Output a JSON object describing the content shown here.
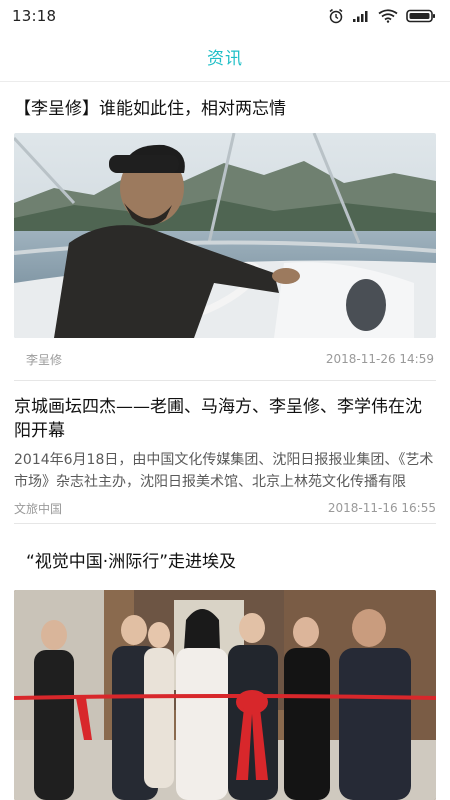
{
  "status_bar": {
    "time": "13:18",
    "icons": [
      "alarm-icon",
      "signal-icon",
      "wifi-icon",
      "battery-icon"
    ]
  },
  "header": {
    "title": "资讯",
    "accent_color": "#1fbfc7"
  },
  "articles": [
    {
      "title": "【李呈修】谁能如此住，相对两忘情",
      "image": "man-on-boat-photo",
      "source": "李呈修",
      "date": "2018-11-26 14:59"
    },
    {
      "title": "京城画坛四杰——老圃、马海方、李呈修、李学伟在沈阳开幕",
      "summary": "2014年6月18日，由中国文化传媒集团、沈阳日报报业集团、《艺术市场》杂志社主办，沈阳日报美术馆、北京上林苑文化传播有限",
      "source": "文旅中国",
      "date": "2018-11-16 16:55"
    },
    {
      "title": "“视觉中国·洲际行”走进埃及",
      "image": "ribbon-cutting-photo"
    }
  ]
}
